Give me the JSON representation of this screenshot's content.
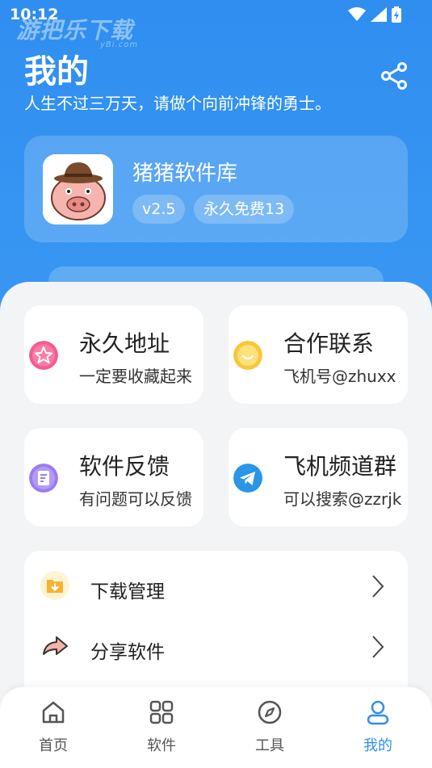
{
  "status": {
    "time": "10:12"
  },
  "watermark": {
    "text": "游把乐下载",
    "sub": "yBi.com"
  },
  "header": {
    "title": "我的",
    "subtitle": "人生不过三万天，请做个向前冲锋的勇士。"
  },
  "app": {
    "name": "猪猪软件库",
    "version": "v2.5",
    "license": "永久免费13"
  },
  "tiles": [
    {
      "title": "永久地址",
      "desc": "一定要收藏起来",
      "icon": "star-icon",
      "color": "#f45b8e"
    },
    {
      "title": "合作联系",
      "desc": "飞机号@zhuxx",
      "icon": "smile-icon",
      "color": "#f7c63a"
    },
    {
      "title": "软件反馈",
      "desc": "有问题可以反馈",
      "icon": "feedback-icon",
      "color": "#9b7bf0"
    },
    {
      "title": "飞机频道群",
      "desc": "可以搜索@zzrjk",
      "icon": "telegram-icon",
      "color": "#2b95e6"
    }
  ],
  "list": [
    {
      "label": "下载管理",
      "icon": "download-folder-icon"
    },
    {
      "label": "分享软件",
      "icon": "share-arrow-icon"
    }
  ],
  "tabs": [
    {
      "label": "首页",
      "icon": "home-icon",
      "active": false
    },
    {
      "label": "软件",
      "icon": "grid-icon",
      "active": false
    },
    {
      "label": "工具",
      "icon": "compass-icon",
      "active": false
    },
    {
      "label": "我的",
      "icon": "user-icon",
      "active": true
    }
  ],
  "colors": {
    "primary": "#2f8ef0",
    "background": "#f3f4f6"
  }
}
